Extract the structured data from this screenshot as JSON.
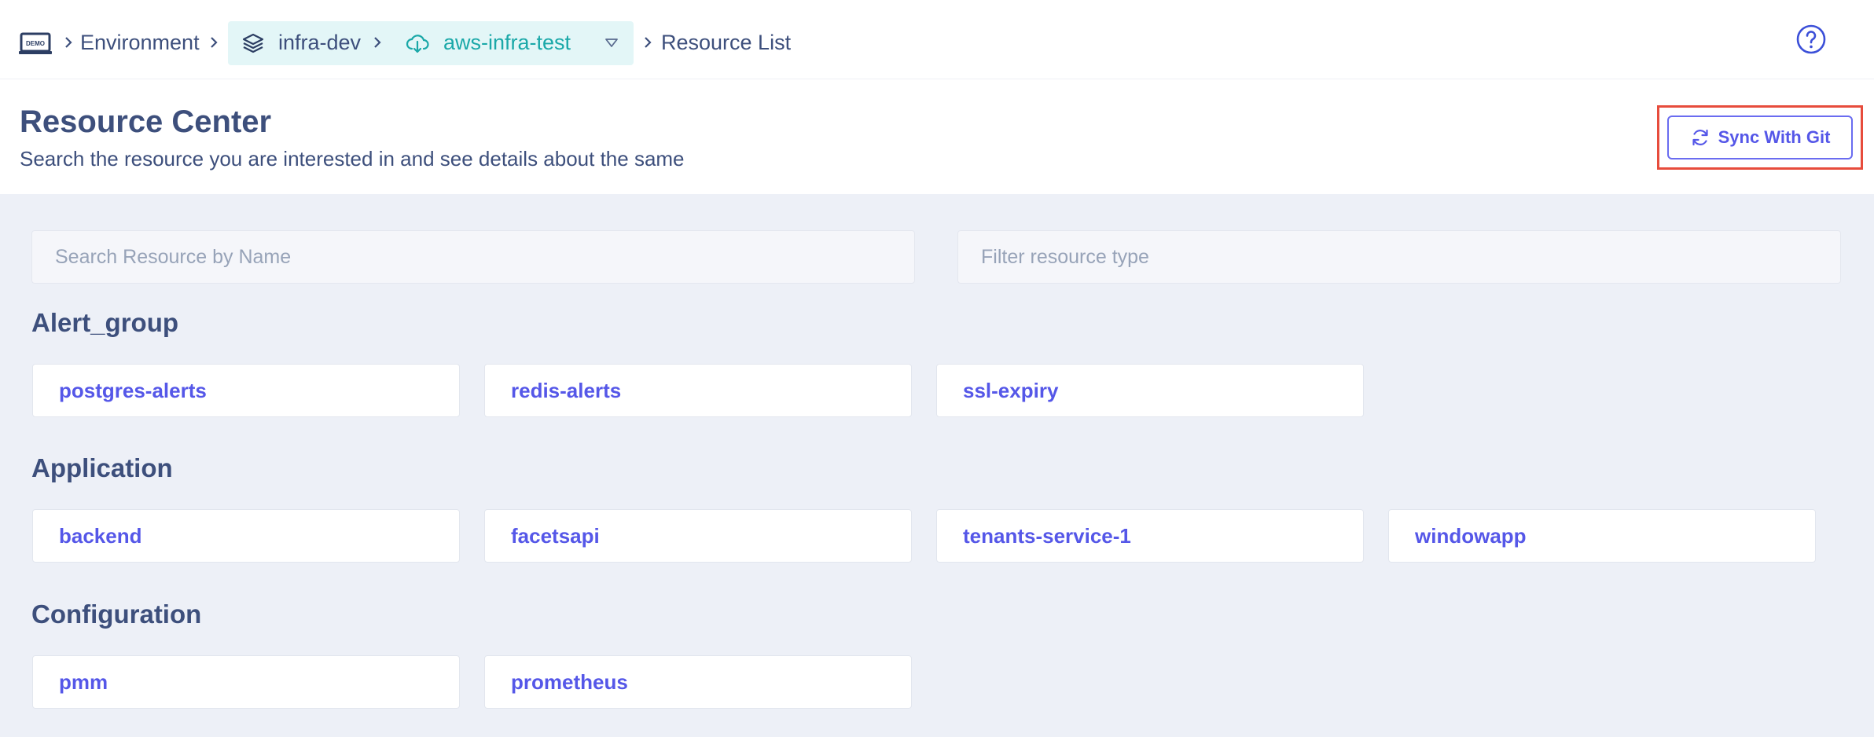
{
  "breadcrumb": {
    "logo_text": "DEMO",
    "items": [
      "Environment",
      "infra-dev",
      "aws-infra-test",
      "Resource List"
    ]
  },
  "header": {
    "title": "Resource Center",
    "subtitle": "Search the resource you are interested in and see details about the same",
    "sync_button": "Sync With Git"
  },
  "search": {
    "name_placeholder": "Search Resource by Name",
    "type_placeholder": "Filter resource type"
  },
  "groups": [
    {
      "title": "Alert_group",
      "items": [
        "postgres-alerts",
        "redis-alerts",
        "ssl-expiry"
      ]
    },
    {
      "title": "Application",
      "items": [
        "backend",
        "facetsapi",
        "tenants-service-1",
        "windowapp"
      ]
    },
    {
      "title": "Configuration",
      "items": [
        "pmm",
        "prometheus"
      ]
    }
  ],
  "colors": {
    "accent": "#5557e8",
    "text": "#3d4f7c",
    "pill_bg": "#e3f6f7",
    "teal": "#1aa8a8",
    "main_bg": "#edf0f7",
    "highlight": "#e74c3c"
  },
  "icons": [
    "demo-logo-icon",
    "chevron-right-icon",
    "layers-icon",
    "cloud-download-icon",
    "caret-down-icon",
    "help-icon",
    "sync-icon"
  ]
}
